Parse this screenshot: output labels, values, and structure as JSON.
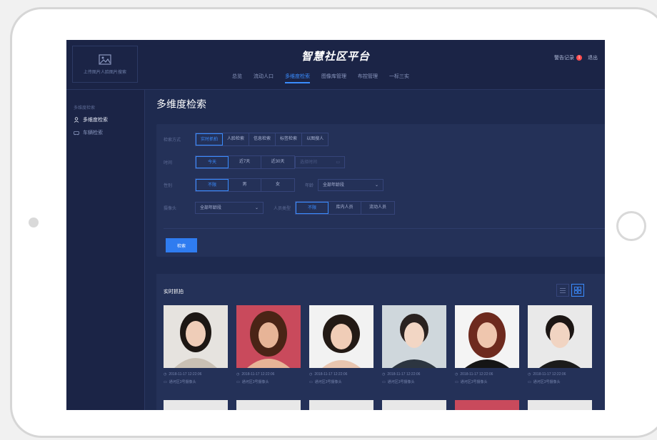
{
  "header": {
    "upload_label": "上传图片人脸图片搜索",
    "title": "智慧社区平台",
    "alarm_label": "警告记录",
    "alarm_count": "1",
    "logout_label": "退出",
    "nav": [
      "总览",
      "流动人口",
      "多维度检索",
      "图像库管理",
      "布控管理",
      "一标三实"
    ],
    "active_nav": 2
  },
  "sidebar": {
    "section_label": "多维度检索",
    "items": [
      {
        "label": "多维度检索",
        "icon": "person-icon",
        "active": true
      },
      {
        "label": "车辆检索",
        "icon": "car-icon",
        "active": false
      }
    ]
  },
  "page": {
    "title": "多维度检索",
    "filters": {
      "method_label": "检索方式",
      "method_options": [
        "实时抓拍",
        "人脸检索",
        "信息检索",
        "标签检索",
        "以图搜人"
      ],
      "time_label": "时间",
      "time_options": [
        "今天",
        "近7天",
        "近30天"
      ],
      "date_placeholder": "选择时间",
      "gender_label": "性别",
      "gender_options": [
        "不限",
        "男",
        "女"
      ],
      "age_label": "年龄",
      "age_value": "全部年龄段",
      "camera_label": "摄像头",
      "camera_value": "全部年龄段",
      "person_type_label": "人员类型",
      "person_type_options": [
        "不限",
        "库内人员",
        "流动人员"
      ],
      "search_button": "检索"
    },
    "capture": {
      "title": "实时抓拍",
      "items": [
        {
          "time": "2018-11-17 12:22:06",
          "camera": "通河区3号摄像头"
        },
        {
          "time": "2018-11-17 12:22:06",
          "camera": "通河区3号摄像头"
        },
        {
          "time": "2018-11-17 12:22:06",
          "camera": "通河区3号摄像头"
        },
        {
          "time": "2018-11-17 12:22:06",
          "camera": "通河区3号摄像头"
        },
        {
          "time": "2018-11-17 12:22:06",
          "camera": "通河区3号摄像头"
        },
        {
          "time": "2018-11-17 12:22:06",
          "camera": "通河区3号摄像头"
        }
      ]
    }
  },
  "colors": {
    "accent": "#3a8cff",
    "background": "#1e2a4f",
    "panel": "#243158",
    "alert": "#ff4d4f"
  }
}
